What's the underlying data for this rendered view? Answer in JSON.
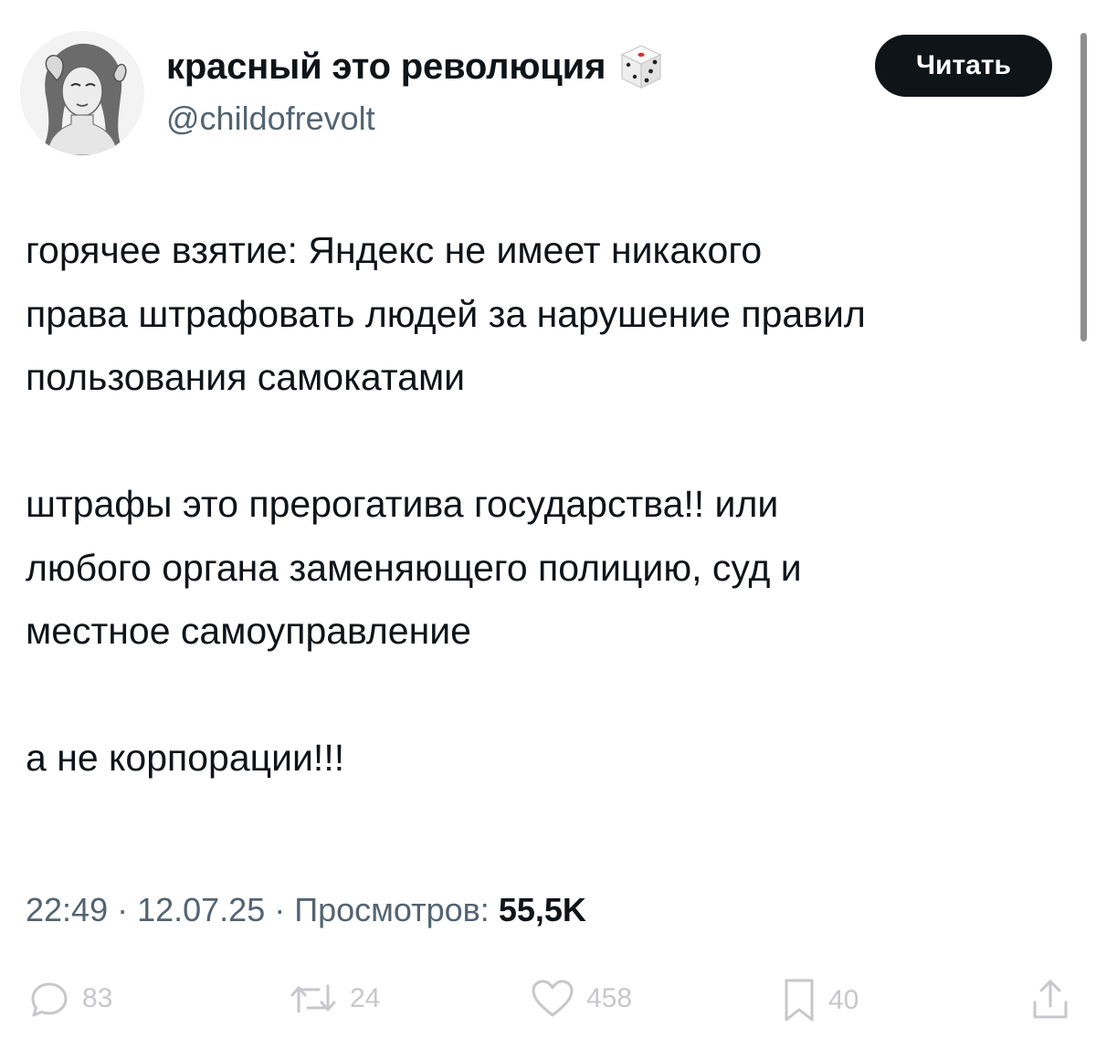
{
  "author": {
    "display_name": "красный это революция",
    "handle": "@childofrevolt",
    "emoji_icon": "dice-icon"
  },
  "follow_button": {
    "label": "Читать"
  },
  "tweet": {
    "paragraphs": [
      {
        "lines": [
          "горячее взятие: Яндекс не имеет никакого",
          "права штрафовать людей за нарушение правил",
          "пользования самокатами"
        ]
      },
      {
        "lines": [
          "штрафы это прерогатива государства!! или",
          "любого органа заменяющего полицию, суд и",
          "местное самоуправление"
        ]
      },
      {
        "lines": [
          "а не корпорации!!!"
        ]
      }
    ]
  },
  "meta": {
    "time": "22:49",
    "separator": "·",
    "date": "12.07.25",
    "views_label": "Просмотров:",
    "views_count": "55,5K"
  },
  "actions": {
    "reply_count": "83",
    "retweet_count": "24",
    "like_count": "458",
    "bookmark_count": "40"
  },
  "colors": {
    "text_primary": "#0f1419",
    "text_secondary": "#536471",
    "action_icon": "#c7c7cc",
    "button_bg": "#0f1419"
  }
}
